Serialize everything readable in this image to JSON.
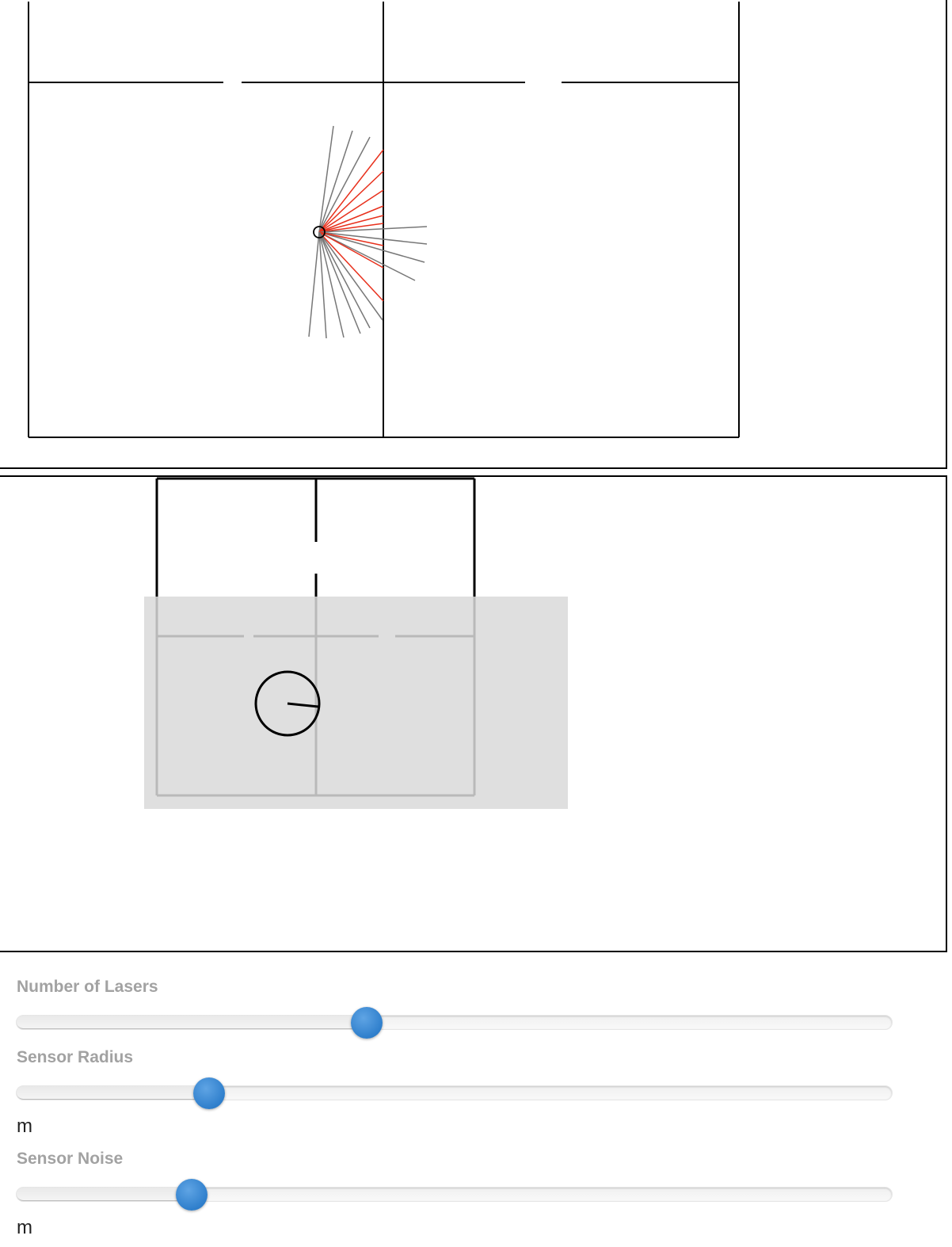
{
  "controls": [
    {
      "label": "Number of Lasers",
      "value": 0.4,
      "unit": ""
    },
    {
      "label": "Sensor Radius",
      "value": 0.22,
      "unit": "m"
    },
    {
      "label": "Sensor Noise",
      "value": 0.2,
      "unit": "m"
    }
  ],
  "colors": {
    "laser_hit": "#e8301c",
    "laser_miss": "#777777",
    "knob": "#3a86d0",
    "label": "#a2a2a2",
    "map_overlay": "#d9d9d9"
  }
}
